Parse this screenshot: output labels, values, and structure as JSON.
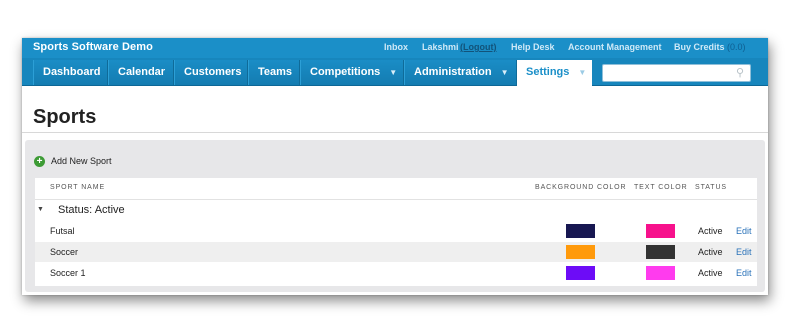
{
  "app": {
    "title": "Sports Software Demo"
  },
  "toplinks": {
    "inbox": "Inbox",
    "user": "Lakshmi",
    "logout": "(Logout)",
    "help": "Help Desk",
    "account": "Account Management",
    "credits": "Buy Credits",
    "credits_count": "(0.0)"
  },
  "nav": {
    "tabs": [
      {
        "label": "Dashboard"
      },
      {
        "label": "Calendar"
      },
      {
        "label": "Customers"
      },
      {
        "label": "Teams"
      },
      {
        "label": "Competitions",
        "caret": "▼"
      },
      {
        "label": "Administration",
        "caret": "▼"
      },
      {
        "label": "Settings",
        "caret": "▼",
        "active": true
      }
    ],
    "search_value": ""
  },
  "page": {
    "title": "Sports"
  },
  "actions": {
    "add_label": "Add New Sport"
  },
  "table": {
    "columns": {
      "name": "SPORT NAME",
      "background": "BACKGROUND COLOR",
      "text": "TEXT COLOR",
      "status": "STATUS"
    },
    "group_label": "Status: Active",
    "edit_label": "Edit",
    "rows": [
      {
        "name": "Futsal",
        "background_color": "#171751",
        "text_color": "#f7118c",
        "status": "Active"
      },
      {
        "name": "Soccer",
        "background_color": "#ff9a0c",
        "text_color": "#333333",
        "status": "Active"
      },
      {
        "name": "Soccer 1",
        "background_color": "#6d0cf7",
        "text_color": "#ff3bee",
        "status": "Active"
      }
    ]
  },
  "colors": {
    "topbar": "#1b8fc8",
    "navbar": "#1786bd",
    "add_icon": "#3d9b35",
    "link": "#2a72b9"
  }
}
